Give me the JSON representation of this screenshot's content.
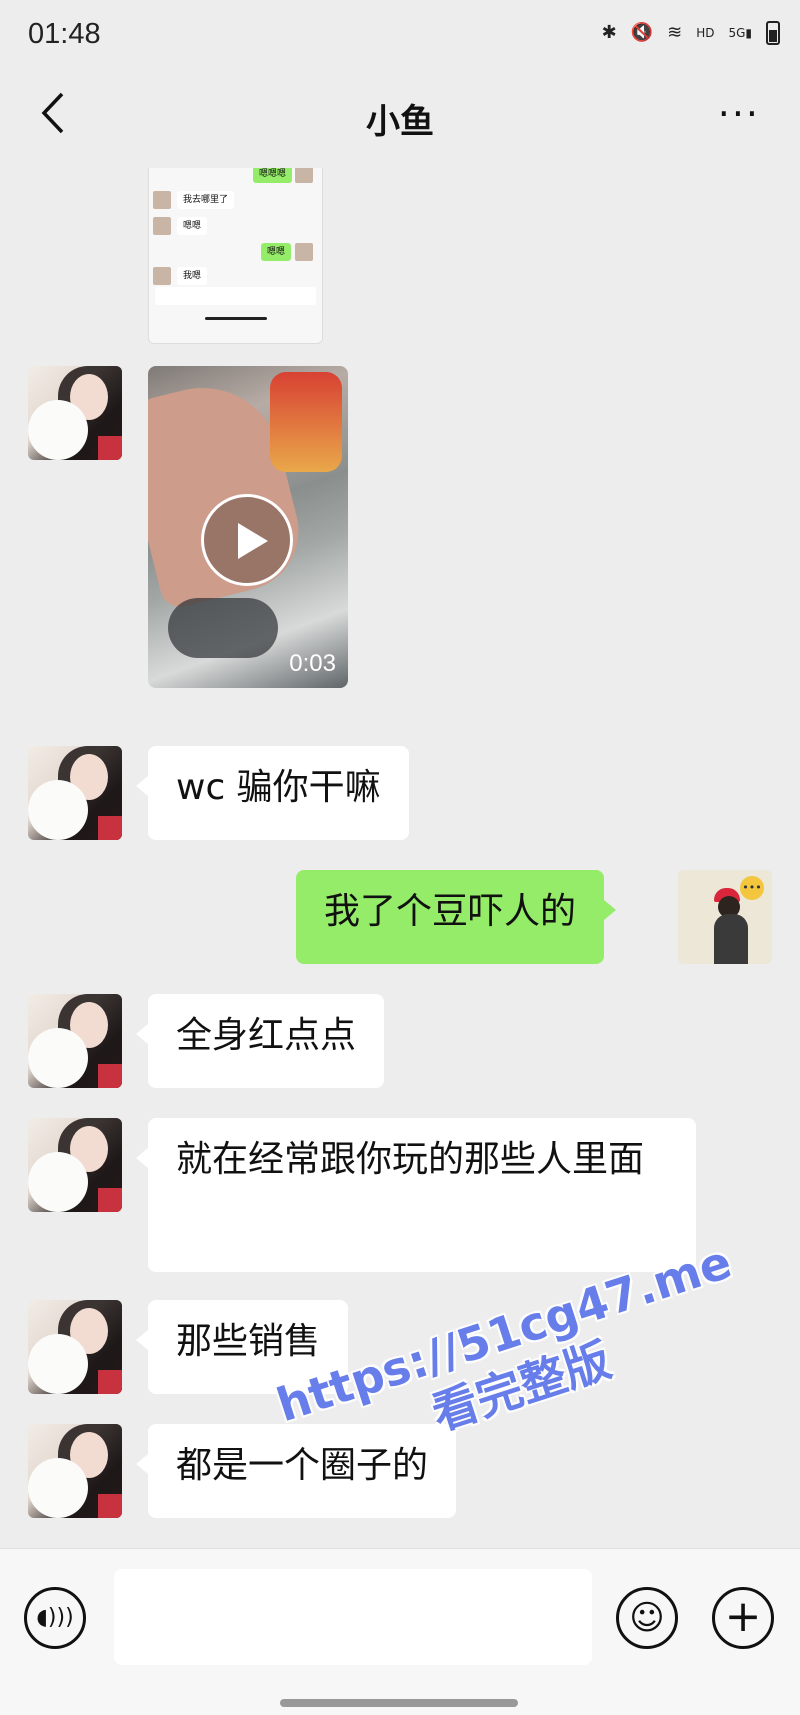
{
  "status_bar": {
    "time": "01:48",
    "icons": [
      "bluetooth-icon",
      "mute-icon",
      "wifi-icon",
      "hd-icon",
      "signal-5g-icon",
      "battery-icon"
    ],
    "hd": "HD",
    "network": "5G"
  },
  "nav": {
    "title": "小鱼",
    "back_icon": "<",
    "more_icon": "..."
  },
  "screenshot_preview": {
    "rows": [
      {
        "side": "right",
        "text": "嗯嗯嗯"
      },
      {
        "side": "left",
        "text": "我去哪里了"
      },
      {
        "side": "left",
        "text": "嗯嗯"
      },
      {
        "side": "right",
        "text": "嗯嗯"
      },
      {
        "side": "left",
        "text": "我嗯"
      }
    ]
  },
  "video_message": {
    "duration": "0:03"
  },
  "messages": [
    {
      "side": "left",
      "text": "wc 骗你干嘛"
    },
    {
      "side": "right",
      "text": "我了个豆吓人的"
    },
    {
      "side": "left",
      "text": "全身红点点"
    },
    {
      "side": "left",
      "text": "就在经常跟你玩的那些人里面"
    },
    {
      "side": "left",
      "text": "那些销售"
    },
    {
      "side": "left",
      "text": "都是一个圈子的"
    }
  ],
  "watermark": {
    "line1": "https://51cg47.me",
    "line2": "看完整版"
  },
  "input_bar": {
    "voice_icon": "voice-icon",
    "emoji_icon": "emoji-icon",
    "plus_icon": "plus-icon"
  },
  "colors": {
    "background": "#ededed",
    "sent_bubble": "#95ec69",
    "received_bubble": "#ffffff",
    "watermark": "#5b74ea"
  }
}
